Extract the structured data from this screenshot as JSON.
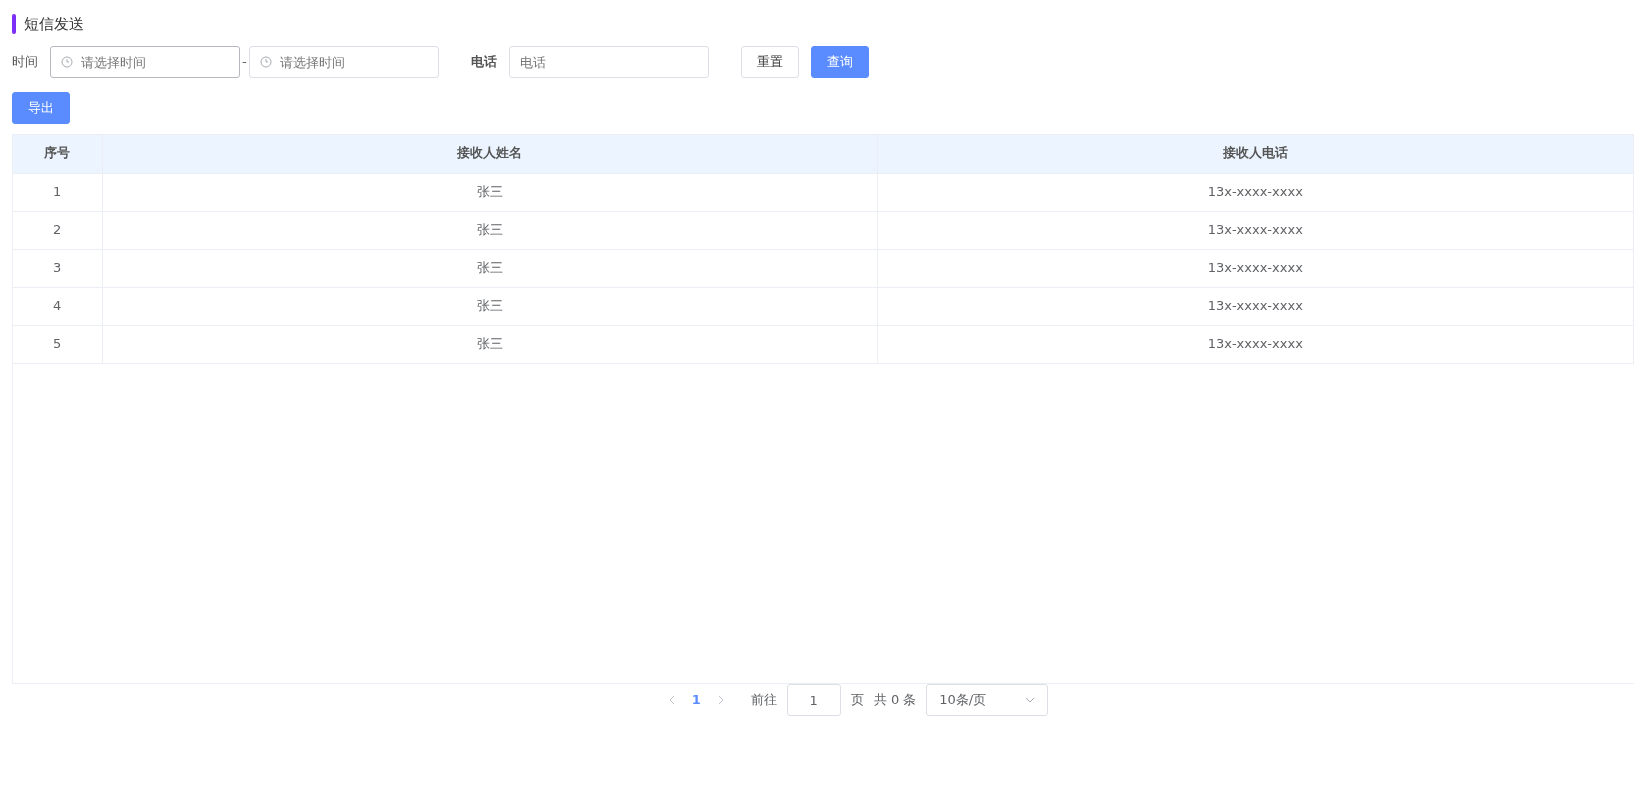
{
  "title": "短信发送",
  "filters": {
    "time_label": "时间",
    "start_placeholder": "请选择时间",
    "separator": "-",
    "end_placeholder": "请选择时间",
    "phone_label": "电话",
    "phone_placeholder": "电话"
  },
  "buttons": [
    {
      "label": "重置",
      "kind": "plain"
    },
    {
      "label": "查询",
      "kind": "primary"
    }
  ],
  "export_button": "导出",
  "table": {
    "columns": [
      "序号",
      "接收人姓名",
      "接收人电话"
    ],
    "rows": [
      [
        "1",
        "张三",
        "13x-xxxx-xxxx"
      ],
      [
        "2",
        "张三",
        "13x-xxxx-xxxx"
      ],
      [
        "3",
        "张三",
        "13x-xxxx-xxxx"
      ],
      [
        "4",
        "张三",
        "13x-xxxx-xxxx"
      ],
      [
        "5",
        "张三",
        "13x-xxxx-xxxx"
      ]
    ]
  },
  "pagination": {
    "pages": [
      {
        "label": "1",
        "selected": true
      }
    ],
    "goto_label": "前往",
    "goto_value": "1",
    "page_unit": "页",
    "total": "共 0 条",
    "page_size": "10条/页"
  }
}
